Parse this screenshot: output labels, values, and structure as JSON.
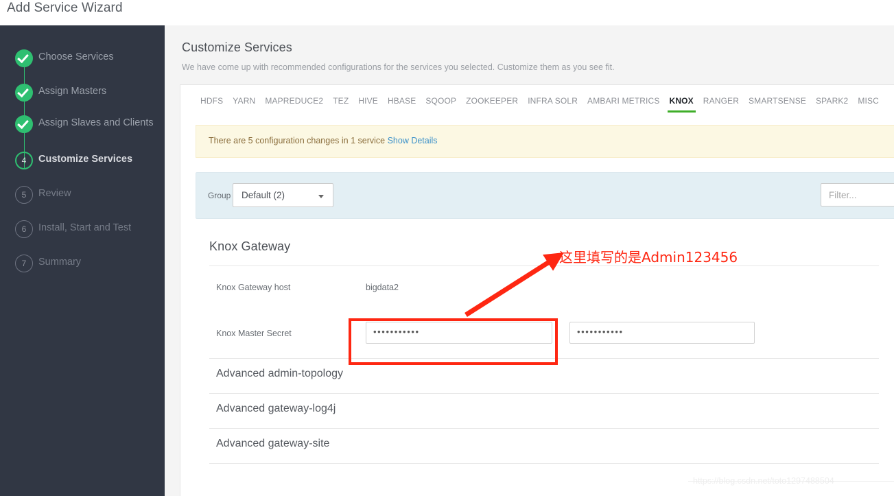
{
  "window": {
    "title": "Add Service Wizard"
  },
  "sidebar": {
    "steps": [
      {
        "num": "1",
        "label": "Choose Services",
        "state": "done"
      },
      {
        "num": "2",
        "label": "Assign Masters",
        "state": "done"
      },
      {
        "num": "3",
        "label": "Assign Slaves and Clients",
        "state": "done"
      },
      {
        "num": "4",
        "label": "Customize Services",
        "state": "current"
      },
      {
        "num": "5",
        "label": "Review",
        "state": "pending"
      },
      {
        "num": "6",
        "label": "Install, Start and Test",
        "state": "pending"
      },
      {
        "num": "7",
        "label": "Summary",
        "state": "pending"
      }
    ]
  },
  "page": {
    "heading": "Customize Services",
    "subheading": "We have come up with recommended configurations for the services you selected. Customize them as you see fit."
  },
  "tabs": [
    {
      "label": "HDFS",
      "active": false
    },
    {
      "label": "YARN",
      "active": false
    },
    {
      "label": "MAPREDUCE2",
      "active": false
    },
    {
      "label": "TEZ",
      "active": false
    },
    {
      "label": "HIVE",
      "active": false
    },
    {
      "label": "HBASE",
      "active": false
    },
    {
      "label": "SQOOP",
      "active": false
    },
    {
      "label": "ZOOKEEPER",
      "active": false
    },
    {
      "label": "INFRA SOLR",
      "active": false
    },
    {
      "label": "AMBARI METRICS",
      "active": false
    },
    {
      "label": "KNOX",
      "active": true
    },
    {
      "label": "RANGER",
      "active": false
    },
    {
      "label": "SMARTSENSE",
      "active": false
    },
    {
      "label": "SPARK2",
      "active": false
    },
    {
      "label": "MISC",
      "active": false
    }
  ],
  "notice": {
    "text": "There are 5 configuration changes in 1 service",
    "link_label": "Show Details"
  },
  "group_bar": {
    "label": "Group",
    "selected": "Default (2)",
    "filter_placeholder": "Filter..."
  },
  "config": {
    "section_title": "Knox Gateway",
    "properties": [
      {
        "name": "Knox Gateway host",
        "type": "text",
        "value": "bigdata2"
      },
      {
        "name": "Knox Master Secret",
        "type": "password",
        "value": "•••••••••••",
        "confirm_value": "•••••••••••"
      }
    ],
    "accordions": [
      {
        "label": "Advanced admin-topology"
      },
      {
        "label": "Advanced gateway-log4j"
      },
      {
        "label": "Advanced gateway-site"
      }
    ]
  },
  "annotation": {
    "text": "这里填写的是Admin123456",
    "color": "#fe2712"
  },
  "watermark": {
    "text": "https://blog.csdn.net/toto1297488504"
  },
  "colors": {
    "sidebar_bg": "#313744",
    "accent_green": "#2fbf71",
    "tab_active_underline": "#3fae29",
    "notice_bg": "#fcf8e3",
    "group_bar_bg": "#e3eff4",
    "link": "#3c91c9",
    "annotation_red": "#fe2712"
  }
}
